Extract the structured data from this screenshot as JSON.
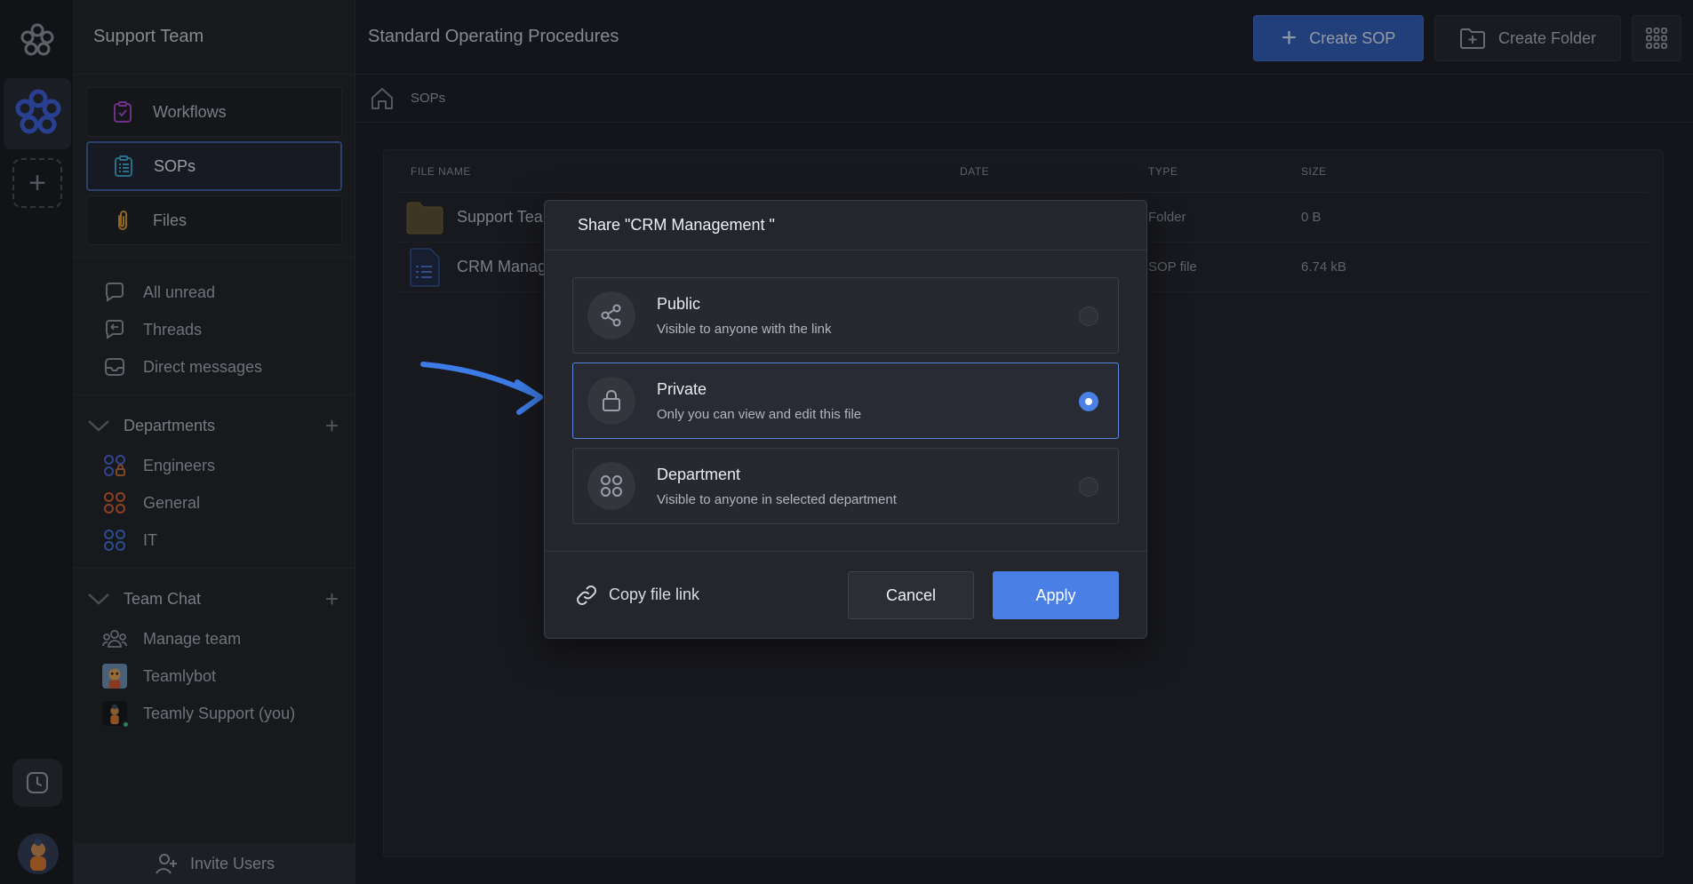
{
  "workspace": {
    "name": "Support Team"
  },
  "sidebar": {
    "nav": [
      {
        "label": "Workflows",
        "icon": "clipboard-check-icon",
        "active": false
      },
      {
        "label": "SOPs",
        "icon": "list-doc-icon",
        "active": true
      },
      {
        "label": "Files",
        "icon": "paperclip-icon",
        "active": false
      }
    ],
    "inbox": [
      {
        "label": "All unread",
        "icon": "chat-bubble-icon"
      },
      {
        "label": "Threads",
        "icon": "threads-icon"
      },
      {
        "label": "Direct messages",
        "icon": "inbox-icon"
      }
    ],
    "departments": {
      "title": "Departments",
      "items": [
        {
          "label": "Engineers",
          "color": "#4568d6"
        },
        {
          "label": "General",
          "color": "#d0622e"
        },
        {
          "label": "IT",
          "color": "#3f6fd8"
        }
      ]
    },
    "team_chat": {
      "title": "Team Chat",
      "items": [
        {
          "label": "Manage team",
          "icon": "team-icon"
        },
        {
          "label": "Teamlybot",
          "icon": "bot-avatar"
        },
        {
          "label": "Teamly Support (you)",
          "icon": "user-avatar"
        }
      ]
    },
    "invite_label": "Invite Users"
  },
  "main": {
    "title": "Standard Operating Procedures",
    "create_sop_label": "Create SOP",
    "create_folder_label": "Create Folder",
    "breadcrumb": "SOPs",
    "table": {
      "headers": {
        "name": "FILE NAME",
        "date": "DATE",
        "type": "TYPE",
        "size": "SIZE"
      },
      "rows": [
        {
          "name": "Support Tea",
          "date": "",
          "type": "Folder",
          "size": "0 B"
        },
        {
          "name": "CRM Manag",
          "date": "",
          "type": "SOP file",
          "size": "6.74 kB"
        }
      ]
    }
  },
  "dialog": {
    "title": "Share \"CRM Management \"",
    "options": [
      {
        "title": "Public",
        "desc": "Visible to anyone with the link",
        "icon": "share-icon",
        "selected": false
      },
      {
        "title": "Private",
        "desc": "Only you can view and edit this file",
        "icon": "lock-icon",
        "selected": true
      },
      {
        "title": "Department",
        "desc": "Visible to anyone in selected department",
        "icon": "department-icon",
        "selected": false
      }
    ],
    "copy_link_label": "Copy file link",
    "cancel_label": "Cancel",
    "apply_label": "Apply"
  },
  "colors": {
    "accent": "#4a7fe6",
    "brand": "#3b5fd9"
  }
}
